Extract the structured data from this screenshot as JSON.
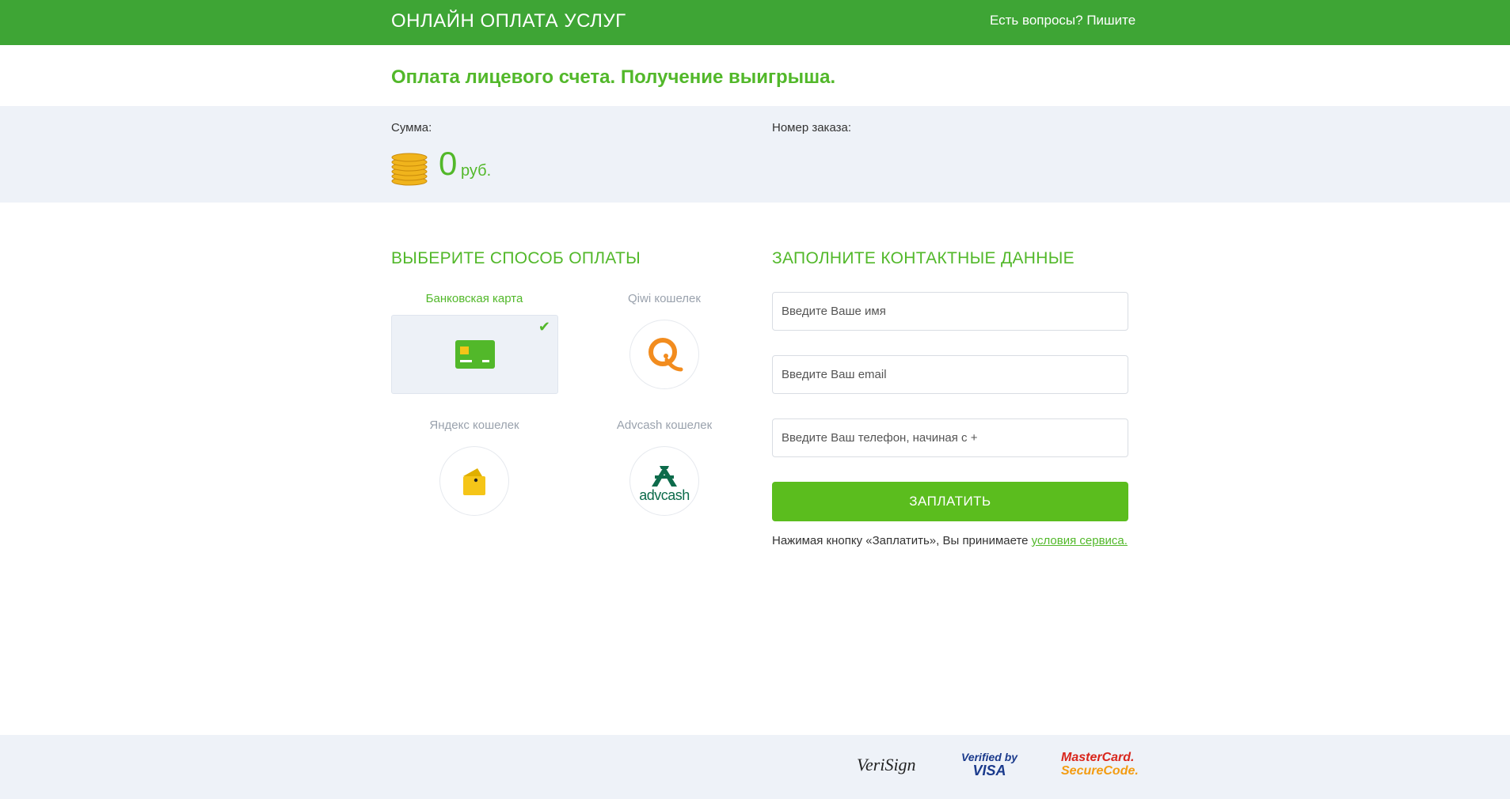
{
  "header": {
    "brand": "ОНЛАЙН ОПЛАТА УСЛУГ",
    "help": "Есть вопросы? Пишите"
  },
  "page_title": "Оплата лицевого счета. Получение выигрыша.",
  "summary": {
    "amount_label": "Сумма:",
    "amount_value": "0",
    "currency": "руб.",
    "order_label": "Номер заказа:"
  },
  "payment": {
    "title": "ВЫБЕРИТЕ СПОСОБ ОПЛАТЫ",
    "methods": [
      {
        "label": "Банковская карта",
        "icon": "bank-card-icon",
        "selected": true
      },
      {
        "label": "Qiwi кошелек",
        "icon": "qiwi-icon",
        "selected": false
      },
      {
        "label": "Яндекс кошелек",
        "icon": "yandex-wallet-icon",
        "selected": false
      },
      {
        "label": "Advcash кошелек",
        "icon": "advcash-icon",
        "selected": false
      }
    ],
    "advcash_word": "advcash"
  },
  "contact": {
    "title": "ЗАПОЛНИТЕ КОНТАКТНЫЕ ДАННЫЕ",
    "name_placeholder": "Введите Ваше имя",
    "email_placeholder": "Введите Ваш email",
    "phone_placeholder": "Введите Ваш телефон, начиная с +",
    "pay_button": "ЗАПЛАТИТЬ",
    "terms_text": "Нажимая кнопку «Заплатить», Вы принимаете ",
    "terms_link": "условия сервиса."
  },
  "footer": {
    "logos": {
      "verisign": "VeriSign",
      "visa_top": "Verified by",
      "visa_bottom": "VISA",
      "mc_top": "MasterCard.",
      "mc_bottom": "SecureCode."
    }
  },
  "colors": {
    "header_green": "#3ea535",
    "accent_green": "#52b82a",
    "button_green": "#5bbd1e",
    "band_bg": "#eef2f8"
  }
}
